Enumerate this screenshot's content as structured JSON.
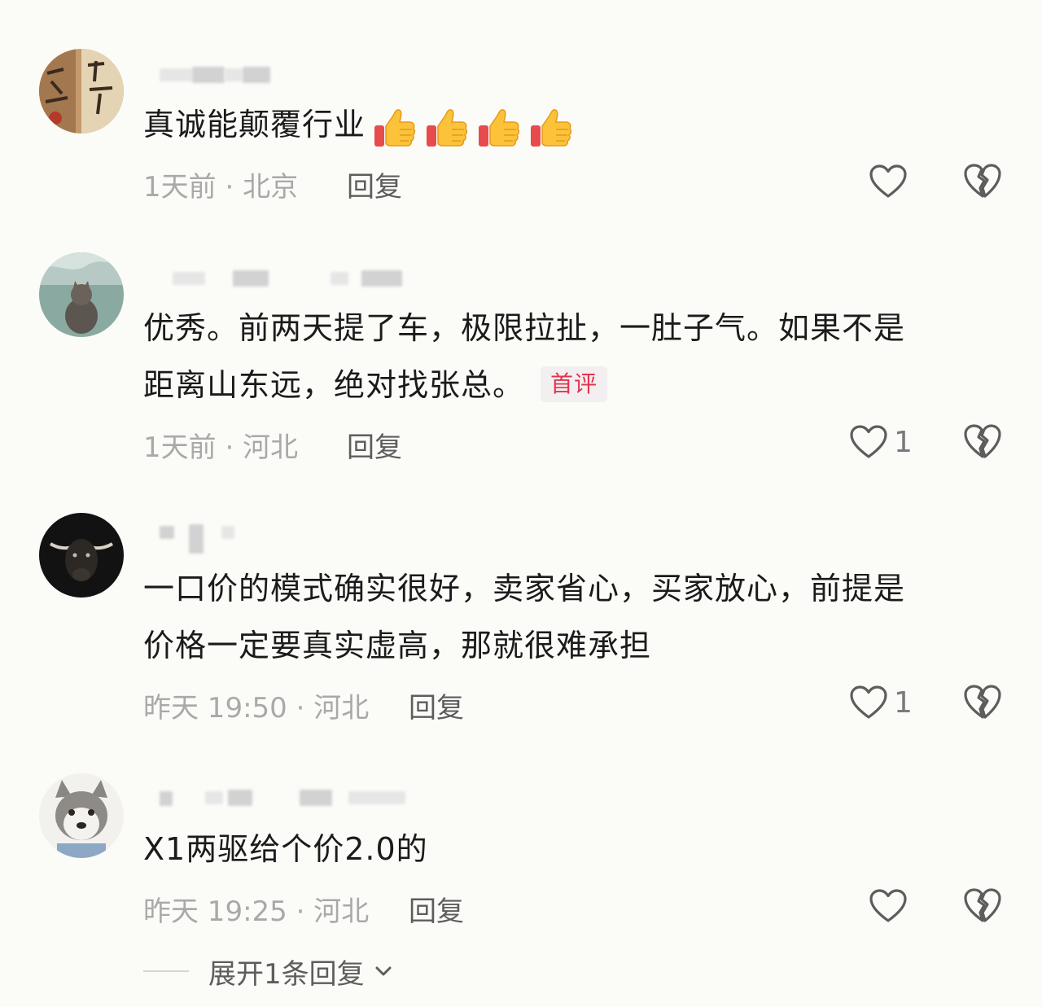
{
  "colors": {
    "background": "#fbfbf8",
    "text": "#1b1b1b",
    "meta": "#a9a9a9",
    "reply": "#5d5d5d",
    "tag": "#e2344f"
  },
  "comments": [
    {
      "text": "真诚能颠覆行业",
      "emojis": [
        "thumbs-up-icon",
        "thumbs-up-icon",
        "thumbs-up-icon",
        "thumbs-up-icon"
      ],
      "time": "1天前",
      "location": "北京",
      "reply_label": "回复",
      "likes": ""
    },
    {
      "text_line1": "优秀。前两天提了车，极限拉扯，一肚子气。如果不是",
      "text_line2": "距离山东远，绝对找张总。",
      "tag": "首评",
      "time": "1天前",
      "location": "河北",
      "reply_label": "回复",
      "likes": "1"
    },
    {
      "text_line1": "一口价的模式确实很好，卖家省心，买家放心，前提是",
      "text_line2": "价格一定要真实虚高，那就很难承担",
      "time": "昨天 19:50",
      "location": "河北",
      "reply_label": "回复",
      "likes": "1"
    },
    {
      "text": "X1两驱给个价2.0的",
      "time": "昨天 19:25",
      "location": "河北",
      "reply_label": "回复",
      "likes": ""
    }
  ],
  "expand": {
    "label": "展开1条回复"
  }
}
